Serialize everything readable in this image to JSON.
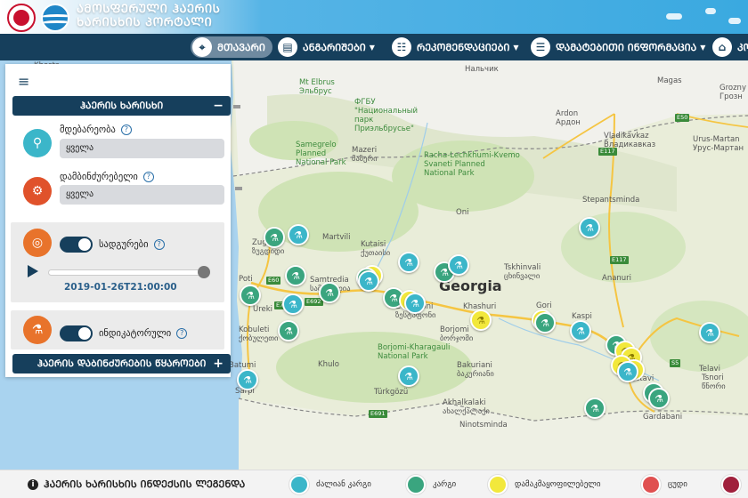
{
  "header": {
    "title_line1": "ᲐᲛᲝᲡᲤᲔᲠᲣᲚᲘ ᲰᲐᲔᲠᲘᲡ",
    "title_line2": "ᲮᲐᲠᲘᲡᲮᲘᲡ ᲞᲝᲠᲢᲐᲚᲘ"
  },
  "nav": {
    "items": [
      {
        "label": "ᲛᲗᲐᲕᲐᲠᲘ",
        "icon": "map-pin-icon"
      },
      {
        "label": "ᲐᲜᲒᲐᲠᲘᲨᲔᲑᲘ",
        "icon": "report-icon"
      },
      {
        "label": "ᲠᲔᲙᲝᲛᲔᲜᲓᲐᲪᲘᲔᲑᲘ",
        "icon": "recommendation-icon"
      },
      {
        "label": "ᲓᲐᲛᲐᲢᲔᲑᲘᲗᲘ ᲘᲜᲤᲝᲠᲛᲐᲪᲘᲐ",
        "icon": "info-doc-icon"
      },
      {
        "label": "ᲙᲝ",
        "icon": "home-icon"
      }
    ]
  },
  "panel": {
    "air_quality_title": "ᲰᲐᲔᲠᲘᲡ ᲮᲐᲠᲘᲡᲮᲘ",
    "location_label": "მდებარეობა",
    "location_value": "ყველა",
    "pollutant_label": "დამბინძურებელი",
    "pollutant_value": "ყველა",
    "stations_label": "სადგურები",
    "timestamp": "2019-01-26T21:00:00",
    "indicative_label": "ინდიკატორული",
    "sources_title": "ᲰᲐᲔᲠᲘᲡ ᲓᲐᲑᲘᲜᲫᲣᲠᲔᲑᲘᲡ ᲬᲧᲐᲠᲝᲔᲑᲘ",
    "collapse_symbol": "−",
    "expand_symbol": "+"
  },
  "map": {
    "country_label": "Georgia",
    "labels": [
      {
        "text": "Khosta",
        "cls": ""
      },
      {
        "text": "Mt Elbrus\nЭльбрус",
        "cls": "green"
      },
      {
        "text": "ФГБУ\n\"Национальный\nпарк\nПриэльбрусье\"",
        "cls": "green"
      },
      {
        "text": "Нальчик",
        "cls": ""
      },
      {
        "text": "Magas",
        "cls": ""
      },
      {
        "text": "Ardon\nАрдон",
        "cls": ""
      },
      {
        "text": "Vladikavkaz\nВладикавказ",
        "cls": ""
      },
      {
        "text": "Urus-Martan\nУрус-Мартан",
        "cls": ""
      },
      {
        "text": "Grozny\nГрозн",
        "cls": ""
      },
      {
        "text": "Racha-Lechkhumi-Kvemo\nSvaneti Planned\nNational Park",
        "cls": "green"
      },
      {
        "text": "Samegrelo\nPlanned\nNational Park",
        "cls": "green"
      },
      {
        "text": "Mazeri\nმაზერი",
        "cls": ""
      },
      {
        "text": "Oni",
        "cls": ""
      },
      {
        "text": "Stepantsminda",
        "cls": ""
      },
      {
        "text": "Zugdidi\nზუგდიდი",
        "cls": ""
      },
      {
        "text": "Martvili",
        "cls": ""
      },
      {
        "text": "Kutaisi\nქუთაისი",
        "cls": ""
      },
      {
        "text": "Samtredia\nსამტრედია",
        "cls": ""
      },
      {
        "text": "Poti",
        "cls": ""
      },
      {
        "text": "Ureki",
        "cls": ""
      },
      {
        "text": "Kobuleti\nქობულეთი",
        "cls": ""
      },
      {
        "text": "Batumi",
        "cls": ""
      },
      {
        "text": "Sarpi",
        "cls": ""
      },
      {
        "text": "Zestaponi\nზესტაფონი",
        "cls": ""
      },
      {
        "text": "Khashuri",
        "cls": ""
      },
      {
        "text": "Borjomi\nბორჯომი",
        "cls": ""
      },
      {
        "text": "Tskhinvali\nცხინვალი",
        "cls": ""
      },
      {
        "text": "Gori",
        "cls": ""
      },
      {
        "text": "Kaspi",
        "cls": ""
      },
      {
        "text": "Ananuri",
        "cls": ""
      },
      {
        "text": "Borjomi-Kharagauli\nNational Park",
        "cls": "green"
      },
      {
        "text": "Khulo",
        "cls": ""
      },
      {
        "text": "Bakuriani\nბაკურიანი",
        "cls": ""
      },
      {
        "text": "Akhalkalaki\nახალქალაქი",
        "cls": ""
      },
      {
        "text": "Ninotsminda",
        "cls": ""
      },
      {
        "text": "Türkgözü",
        "cls": ""
      },
      {
        "text": "Telavi",
        "cls": ""
      },
      {
        "text": "Rustavi",
        "cls": ""
      },
      {
        "text": "Gardabani",
        "cls": ""
      },
      {
        "text": "Tsnori\nწნორი",
        "cls": ""
      }
    ]
  },
  "legend": {
    "title": "ᲰᲐᲔᲠᲘᲡ ᲮᲐᲠᲘᲡᲮᲘᲡ ᲘᲜᲓᲔᲥᲡᲘᲡ ᲚᲔᲒᲔᲜᲓᲐ",
    "info_symbol": "i",
    "items": [
      {
        "label": "ძალიან კარგი",
        "color": "#3bb6c9"
      },
      {
        "label": "კარგი",
        "color": "#3aa57f"
      },
      {
        "label": "დამაკმაყოფილებელი",
        "color": "#f2e83c"
      },
      {
        "label": "ცუდი",
        "color": "#e05050"
      },
      {
        "label": "",
        "color": "#a0203c"
      }
    ]
  },
  "colors": {
    "navy": "#163f5c",
    "accent_blue": "#3aa9e0"
  }
}
